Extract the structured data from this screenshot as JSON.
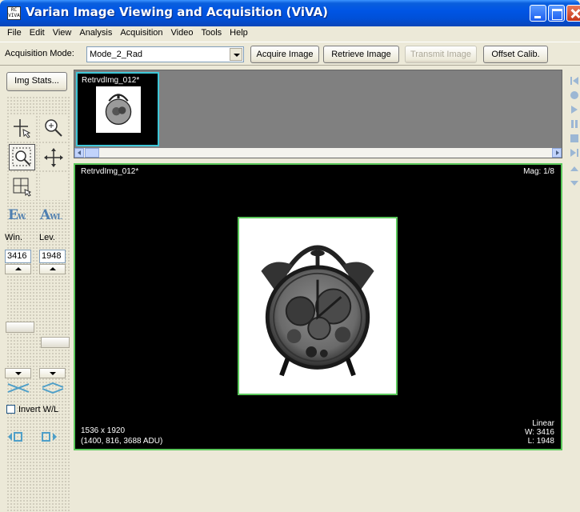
{
  "window": {
    "title": "Varian Image Viewing and Acquisition (ViVA)",
    "icon_text": [
      "RC",
      "VIVA"
    ]
  },
  "menu": [
    "File",
    "Edit",
    "View",
    "Analysis",
    "Acquisition",
    "Video",
    "Tools",
    "Help"
  ],
  "toolbar": {
    "mode_label": "Acquisition Mode:",
    "mode_value": "Mode_2_Rad",
    "acquire_label": "Acquire Image",
    "retrieve_label": "Retrieve Image",
    "transmit_label": "Transmit Image",
    "offset_label": "Offset Calib."
  },
  "left_panel": {
    "img_stats_label": "Img Stats...",
    "ew_label": "E",
    "ew_sub": "W.",
    "aw_label": "A",
    "aw_sub": "WL",
    "win_label": "Win.",
    "lev_label": "Lev.",
    "win_value": "3416",
    "lev_value": "1948",
    "invert_label": "Invert W/L",
    "invert_checked": false
  },
  "thumbnail": {
    "title": "RetrvdImg_012*"
  },
  "viewer": {
    "title": "RetrvdImg_012*",
    "mag": "Mag: 1/8",
    "dims": "1536 x 1920",
    "pixel_info": "(1400, 816, 3688 ADU)",
    "lut": "Linear",
    "window": "W: 3416",
    "level": "L: 1948"
  },
  "colors": {
    "titlebar": "#0055e5",
    "selection_green": "#5bc85b",
    "thumb_border": "#3ec7d8",
    "ew_blue": "#4f7fb0"
  },
  "icons": [
    "crosshair-cursor-icon",
    "zoom-icon",
    "zoom-region-icon",
    "pan-icon",
    "roi-grid-icon",
    "previous-icon",
    "next-icon",
    "first-frame-icon",
    "record-icon",
    "play-icon",
    "pause-icon",
    "stop-icon",
    "last-frame-icon",
    "scroll-up-icon",
    "scroll-down-icon"
  ]
}
